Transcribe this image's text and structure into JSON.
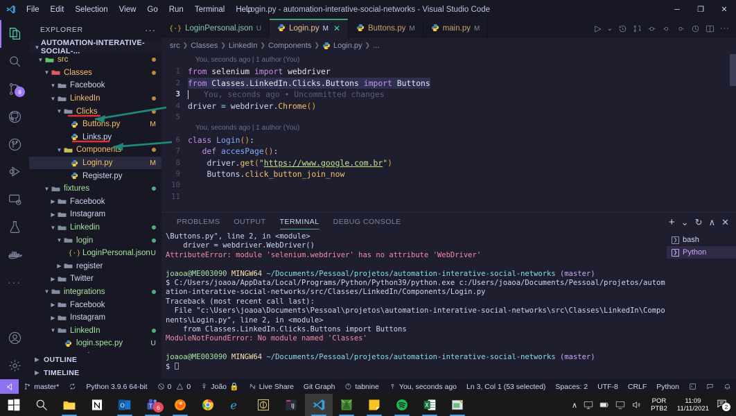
{
  "window": {
    "title": "Login.py - automation-interative-social-networks - Visual Studio Code",
    "menu": [
      "File",
      "Edit",
      "Selection",
      "View",
      "Go",
      "Run",
      "Terminal",
      "Help"
    ],
    "controls": {
      "minimize": "─",
      "maximize": "❐",
      "close": "✕"
    }
  },
  "activitybar": {
    "items": [
      {
        "name": "explorer",
        "badge": ""
      },
      {
        "name": "search",
        "badge": ""
      },
      {
        "name": "source-control",
        "badge": "8"
      },
      {
        "name": "github",
        "badge": ""
      },
      {
        "name": "git-branch",
        "badge": ""
      },
      {
        "name": "run-and-debug",
        "badge": ""
      },
      {
        "name": "remote-explorer",
        "badge": ""
      },
      {
        "name": "testing",
        "badge": ""
      },
      {
        "name": "docker",
        "badge": ""
      }
    ],
    "more": "···"
  },
  "explorer": {
    "header": "EXPLORER",
    "header_actions": "···",
    "root": "AUTOMATION-INTERATIVE-SOCIAL-...",
    "items": [
      {
        "label": "src",
        "indent": 1,
        "type": "folder",
        "icon": "folder-src",
        "expanded": true,
        "color": "#f5c06b",
        "dot": "#c08a3e",
        "status": ""
      },
      {
        "label": "Classes",
        "indent": 2,
        "type": "folder",
        "icon": "folder-class",
        "expanded": true,
        "color": "#f5c06b",
        "dot": "#c08a3e",
        "status": ""
      },
      {
        "label": "Facebook",
        "indent": 3,
        "type": "folder",
        "icon": "folder",
        "expanded": true,
        "color": "#cdd6f4",
        "dot": "",
        "status": ""
      },
      {
        "label": "LinkedIn",
        "indent": 3,
        "type": "folder",
        "icon": "folder",
        "expanded": true,
        "color": "#f5c06b",
        "dot": "#c08a3e",
        "status": ""
      },
      {
        "label": "Clicks",
        "indent": 4,
        "type": "folder",
        "icon": "folder",
        "expanded": true,
        "color": "#f5c06b",
        "dot": "#c08a3e",
        "status": ""
      },
      {
        "label": "Buttons.py",
        "indent": 5,
        "type": "file",
        "icon": "python",
        "expanded": null,
        "color": "#f5c06b",
        "dot": "",
        "status": "M"
      },
      {
        "label": "Links.py",
        "indent": 5,
        "type": "file",
        "icon": "python",
        "expanded": null,
        "color": "#cdd6f4",
        "dot": "",
        "status": ""
      },
      {
        "label": "Components",
        "indent": 4,
        "type": "folder",
        "icon": "folder-comp",
        "expanded": true,
        "color": "#f5c06b",
        "dot": "#c08a3e",
        "status": ""
      },
      {
        "label": "Login.py",
        "indent": 5,
        "type": "file",
        "icon": "python",
        "expanded": null,
        "color": "#f5c06b",
        "dot": "",
        "status": "M",
        "selected": true
      },
      {
        "label": "Register.py",
        "indent": 5,
        "type": "file",
        "icon": "python",
        "expanded": null,
        "color": "#cdd6f4",
        "dot": "",
        "status": ""
      },
      {
        "label": "fixtures",
        "indent": 2,
        "type": "folder",
        "icon": "folder",
        "expanded": true,
        "color": "#a6e3a1",
        "dot": "#4caf7d",
        "status": ""
      },
      {
        "label": "Facebook",
        "indent": 3,
        "type": "folder",
        "icon": "folder",
        "expanded": false,
        "color": "#cdd6f4",
        "dot": "",
        "status": ""
      },
      {
        "label": "Instagram",
        "indent": 3,
        "type": "folder",
        "icon": "folder",
        "expanded": false,
        "color": "#cdd6f4",
        "dot": "",
        "status": ""
      },
      {
        "label": "Linkedin",
        "indent": 3,
        "type": "folder",
        "icon": "folder",
        "expanded": true,
        "color": "#a6e3a1",
        "dot": "#4caf7d",
        "status": ""
      },
      {
        "label": "login",
        "indent": 4,
        "type": "folder",
        "icon": "folder",
        "expanded": true,
        "color": "#a6e3a1",
        "dot": "#4caf7d",
        "status": ""
      },
      {
        "label": "LoginPersonal.json",
        "indent": 5,
        "type": "file",
        "icon": "json",
        "expanded": null,
        "color": "#a6e3a1",
        "dot": "",
        "status": "U"
      },
      {
        "label": "register",
        "indent": 4,
        "type": "folder",
        "icon": "folder",
        "expanded": false,
        "color": "#cdd6f4",
        "dot": "",
        "status": ""
      },
      {
        "label": "Twitter",
        "indent": 3,
        "type": "folder",
        "icon": "folder",
        "expanded": false,
        "color": "#cdd6f4",
        "dot": "",
        "status": ""
      },
      {
        "label": "integrations",
        "indent": 2,
        "type": "folder",
        "icon": "folder",
        "expanded": true,
        "color": "#a6e3a1",
        "dot": "#4caf7d",
        "status": ""
      },
      {
        "label": "Facebook",
        "indent": 3,
        "type": "folder",
        "icon": "folder",
        "expanded": false,
        "color": "#cdd6f4",
        "dot": "",
        "status": ""
      },
      {
        "label": "Instagram",
        "indent": 3,
        "type": "folder",
        "icon": "folder",
        "expanded": false,
        "color": "#cdd6f4",
        "dot": "",
        "status": ""
      },
      {
        "label": "LinkedIn",
        "indent": 3,
        "type": "folder",
        "icon": "folder",
        "expanded": true,
        "color": "#a6e3a1",
        "dot": "#4caf7d",
        "status": ""
      },
      {
        "label": "login.spec.py",
        "indent": 4,
        "type": "file",
        "icon": "python",
        "expanded": null,
        "color": "#a6e3a1",
        "dot": "",
        "status": "U"
      },
      {
        "label": "register.spec.py",
        "indent": 4,
        "type": "file",
        "icon": "python",
        "expanded": null,
        "color": "#a6e3a1",
        "dot": "",
        "status": "U"
      }
    ],
    "sections": [
      {
        "label": "OUTLINE"
      },
      {
        "label": "TIMELINE"
      }
    ]
  },
  "tabs": [
    {
      "label": "LoginPersonal.json",
      "icon": "json",
      "status": "U",
      "active": false,
      "closable": false
    },
    {
      "label": "Login.py",
      "icon": "python",
      "status": "M",
      "active": true,
      "closable": true
    },
    {
      "label": "Buttons.py",
      "icon": "python",
      "status": "M",
      "active": false,
      "closable": false
    },
    {
      "label": "main.py",
      "icon": "python",
      "status": "M",
      "active": false,
      "closable": false
    }
  ],
  "editor_actions": {
    "run": "▷",
    "run_dropdown": "⌄",
    "more": "···"
  },
  "breadcrumb": [
    "src",
    "Classes",
    "LinkedIn",
    "Components",
    "Login.py",
    "..."
  ],
  "code": {
    "lens1": "You, seconds ago | 1 author (You)",
    "lens2": "You, seconds ago | 1 author (You)",
    "ghost_line": "You, seconds ago • Uncommitted changes",
    "lines": [
      {
        "num": "1",
        "text": "from selenium import webdriver"
      },
      {
        "num": "2",
        "text": "from Classes.LinkedIn.Clicks.Buttons import Buttons"
      },
      {
        "num": "3",
        "text": ""
      },
      {
        "num": "4",
        "text": "driver = webdriver.Chrome()"
      },
      {
        "num": "5",
        "text": ""
      },
      {
        "num": "6",
        "text": "class Login():"
      },
      {
        "num": "7",
        "text": "    def accesPage():"
      },
      {
        "num": "8",
        "text": "        driver.get(\"https://www.google.com.br\")"
      },
      {
        "num": "9",
        "text": "        Buttons.click_button_join_now"
      },
      {
        "num": "10",
        "text": ""
      },
      {
        "num": "11",
        "text": ""
      }
    ]
  },
  "panel": {
    "tabs": [
      "PROBLEMS",
      "OUTPUT",
      "TERMINAL",
      "DEBUG CONSOLE"
    ],
    "active_tab": "TERMINAL",
    "actions": {
      "add": "+",
      "dropdown": "⌄",
      "split": "↻",
      "chevron_up": "∧",
      "close": "✕"
    },
    "terminal_list": [
      {
        "label": "bash",
        "selected": false
      },
      {
        "label": "Python",
        "selected": true
      }
    ],
    "terminal_lines": [
      {
        "kind": "white",
        "text": "\\Buttons.py\", line 2, in <module>"
      },
      {
        "kind": "white",
        "text": "    driver = webdriver.WebDriver()"
      },
      {
        "kind": "red",
        "text": "AttributeError: module 'selenium.webdriver' has no attribute 'WebDriver'"
      },
      {
        "kind": "blank",
        "text": ""
      },
      {
        "kind": "prompt",
        "user": "joaoa@ME003090",
        "shell": "MINGW64",
        "path": "~/Documents/Pessoal/projetos/automation-interative-social-networks",
        "branch": "(master)"
      },
      {
        "kind": "white",
        "text": "$ C:/Users/joaoa/AppData/Local/Programs/Python/Python39/python.exe c:/Users/joaoa/Documents/Pessoal/projetos/automation-interative-social-networks/src/Classes/LinkedIn/Components/Login.py"
      },
      {
        "kind": "white",
        "text": "Traceback (most recent call last):"
      },
      {
        "kind": "white",
        "text": "  File \"c:\\Users\\joaoa\\Documents\\Pessoal\\projetos\\automation-interative-social-networks\\src\\Classes\\LinkedIn\\Components\\Login.py\", line 2, in <module>"
      },
      {
        "kind": "white",
        "text": "    from Classes.LinkedIn.Clicks.Buttons import Buttons"
      },
      {
        "kind": "red",
        "text": "ModuleNotFoundError: No module named 'Classes'"
      },
      {
        "kind": "blank",
        "text": ""
      },
      {
        "kind": "prompt",
        "user": "joaoa@ME003090",
        "shell": "MINGW64",
        "path": "~/Documents/Pessoal/projetos/automation-interative-social-networks",
        "branch": "(master)"
      },
      {
        "kind": "cursor",
        "text": "$ "
      }
    ]
  },
  "statusbar": {
    "left": [
      {
        "name": "remote-indicator",
        "label": ""
      },
      {
        "name": "branch",
        "label": "master*",
        "icon": "branch"
      },
      {
        "name": "sync",
        "label": "",
        "icon": "sync"
      },
      {
        "name": "python-version",
        "label": "Python 3.9.6 64-bit",
        "icon": ""
      },
      {
        "name": "problems",
        "label": "0  0",
        "icon": "error-warning"
      },
      {
        "name": "account",
        "label": "João",
        "icon": "account"
      },
      {
        "name": "lock",
        "label": "",
        "icon": "lock"
      },
      {
        "name": "live-share",
        "label": "Live Share",
        "icon": "live-share"
      },
      {
        "name": "git-graph",
        "label": "Git Graph",
        "icon": ""
      },
      {
        "name": "tabnine",
        "label": "tabnine",
        "icon": "tabnine"
      }
    ],
    "right": [
      {
        "name": "git-blame",
        "label": "You, seconds ago",
        "icon": "blame"
      },
      {
        "name": "cursor-position",
        "label": "Ln 3, Col 1 (53 selected)",
        "icon": ""
      },
      {
        "name": "indentation",
        "label": "Spaces: 2",
        "icon": ""
      },
      {
        "name": "encoding",
        "label": "UTF-8",
        "icon": ""
      },
      {
        "name": "eol",
        "label": "CRLF",
        "icon": ""
      },
      {
        "name": "language-mode",
        "label": "Python",
        "icon": ""
      },
      {
        "name": "terminal-toggle",
        "label": "",
        "icon": "terminal"
      },
      {
        "name": "feedback",
        "label": "",
        "icon": "feedback"
      },
      {
        "name": "notifications",
        "label": "",
        "icon": "bell"
      }
    ],
    "problem_errors": "0",
    "problem_warnings": "0"
  },
  "taskbar": {
    "items": [
      {
        "name": "start",
        "running": false
      },
      {
        "name": "search",
        "running": false
      },
      {
        "name": "file-explorer",
        "running": true
      },
      {
        "name": "notion",
        "running": false
      },
      {
        "name": "outlook",
        "running": true
      },
      {
        "name": "microsoft-teams",
        "running": true,
        "badge": "6"
      },
      {
        "name": "firefox",
        "running": true
      },
      {
        "name": "chrome",
        "running": false
      },
      {
        "name": "internet-explorer",
        "running": false
      },
      {
        "name": "cisco-anyconnect",
        "running": false
      },
      {
        "name": "intellij-idea",
        "running": false
      },
      {
        "name": "visual-studio-code",
        "running": true,
        "active": true
      },
      {
        "name": "paint-net",
        "running": true
      },
      {
        "name": "sticky-notes",
        "running": true
      },
      {
        "name": "spotify",
        "running": true
      },
      {
        "name": "excel",
        "running": true
      },
      {
        "name": "money-app",
        "running": true
      }
    ],
    "tray": {
      "chevron": "∧"
    },
    "language": {
      "line1": "POR",
      "line2": "PTB2"
    },
    "clock": {
      "time": "11:09",
      "date": "11/11/2021"
    },
    "notifications_count": "2"
  },
  "annotations": {
    "underline_color": "#e03131",
    "arrow_color": "#1b8a7a",
    "arrows": 2
  }
}
